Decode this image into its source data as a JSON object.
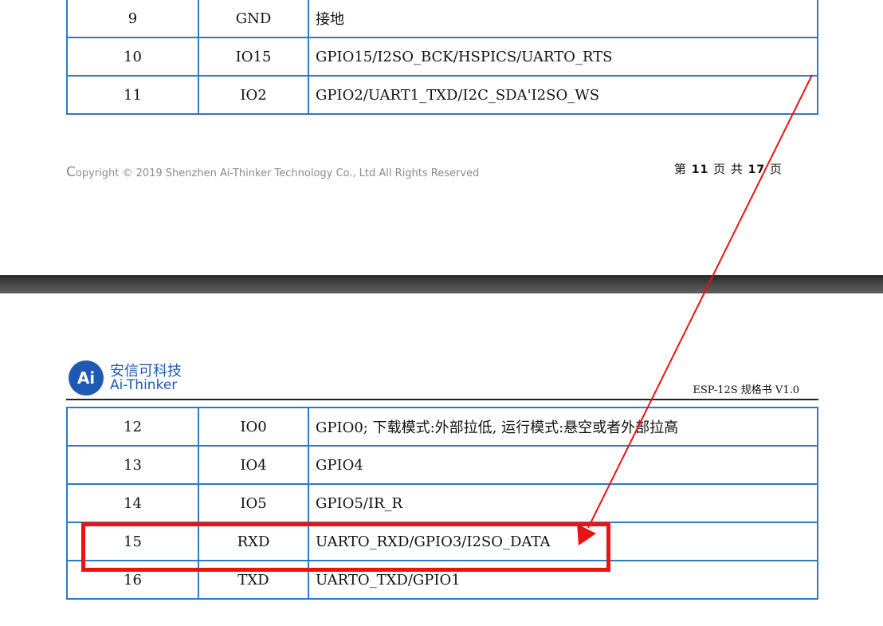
{
  "page_top": {
    "rows": [
      {
        "num": "9",
        "name": "GND",
        "desc": "接地"
      },
      {
        "num": "10",
        "name": "IO15",
        "desc": "GPIO15/I2SO_BCK/HSPICS/UARTO_RTS"
      },
      {
        "num": "11",
        "name": "IO2",
        "desc": "GPIO2/UART1_TXD/I2C_SDA'I2SO_WS"
      }
    ],
    "footer": {
      "copyright_c": "C",
      "copyright_rest": "opyright © 2019   Shenzhen Ai-Thinker Technology Co., Ltd All Rights Reserved",
      "page_prefix": "第",
      "page_current": "11",
      "page_middle": "页 共",
      "page_total": "17",
      "page_suffix": "页"
    }
  },
  "page_bottom": {
    "logo": {
      "badge": "Ai",
      "name_cn": "安信可科技",
      "name_en": "Ai-Thinker"
    },
    "doc_title": "ESP-12S 规格书 V1.0",
    "rows": [
      {
        "num": "12",
        "name": "IO0",
        "desc": "GPIO0; 下载模式:外部拉低, 运行模式:悬空或者外部拉高"
      },
      {
        "num": "13",
        "name": "IO4",
        "desc": "GPIO4"
      },
      {
        "num": "14",
        "name": "IO5",
        "desc": "GPIO5/IR_R"
      },
      {
        "num": "15",
        "name": "RXD",
        "desc": "UARTO_RXD/GPIO3/I2SO_DATA"
      },
      {
        "num": "16",
        "name": "TXD",
        "desc": "UARTO_TXD/GPIO1"
      }
    ]
  },
  "annotations": {
    "highlight_color": "#ee1111",
    "highlighted_row": "15"
  }
}
